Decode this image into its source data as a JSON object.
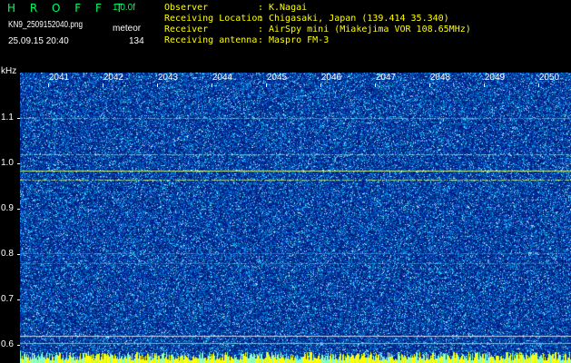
{
  "app": {
    "title": "H R O F F T",
    "version": "1.0.0f"
  },
  "capture": {
    "file_name": "KN9_2509152040.png",
    "mode": "meteor",
    "date_time": "25.09.15 20:40",
    "count": "134"
  },
  "station": {
    "fields": [
      {
        "label": "Observer",
        "value": "K.Nagai"
      },
      {
        "label": "Receiving Location",
        "value": "Chigasaki, Japan (139.414 35.340)"
      },
      {
        "label": "Receiver",
        "value": "AirSpy mini (Miakejima VOR 108.65MHz)"
      },
      {
        "label": "Receiving antenna",
        "value": "Maspro FM-3"
      }
    ],
    "separator": ":"
  },
  "axis": {
    "unit": "kHz",
    "y_ticks": [
      "1.1",
      "1.0",
      "0.9",
      "0.8",
      "0.7",
      "0.6"
    ],
    "x_ticks": [
      "2041",
      "2042",
      "2043",
      "2044",
      "2045",
      "2046",
      "2047",
      "2048",
      "2049",
      "2050"
    ]
  },
  "colors": {
    "background": "#000000",
    "noise_base": "#001c8c",
    "trace": "#9fe8ff",
    "strong_trace": "#d8ff7a",
    "baseline": "#ffff00",
    "title_green": "#00ff66",
    "info_yellow": "#ffff00"
  }
}
